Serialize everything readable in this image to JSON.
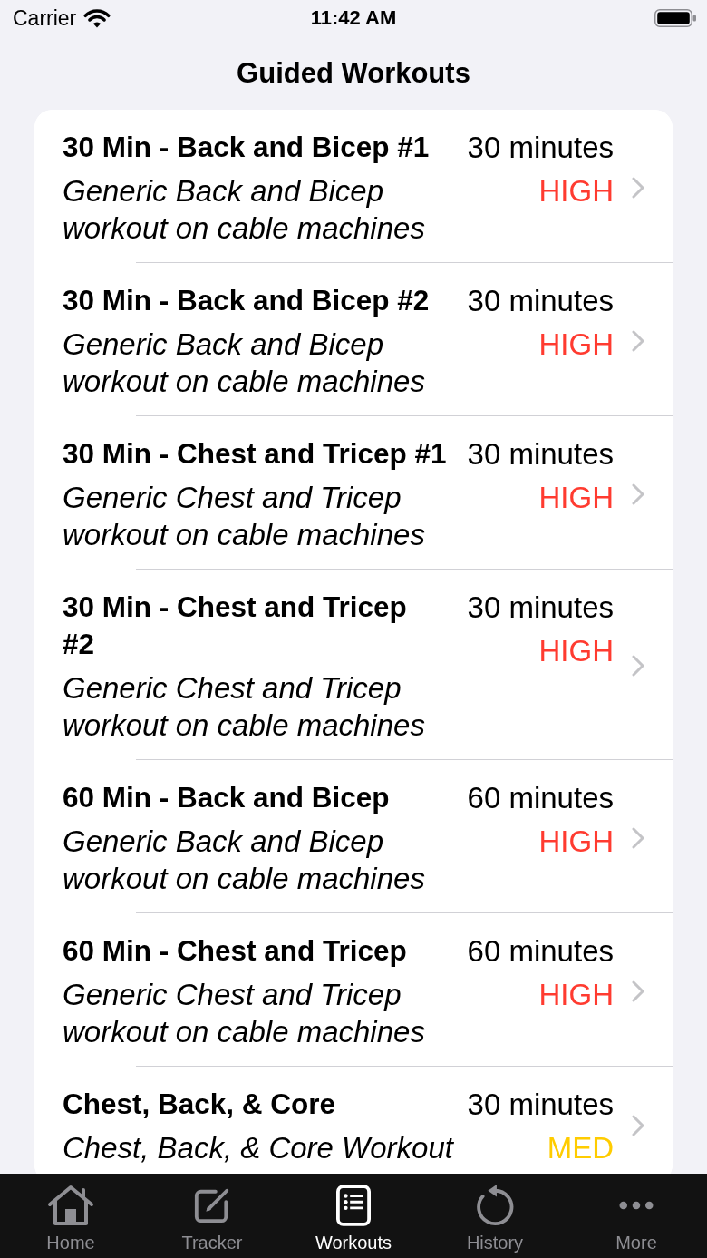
{
  "status_bar": {
    "carrier": "Carrier",
    "time": "11:42 AM"
  },
  "navigation": {
    "title": "Guided Workouts"
  },
  "workouts": [
    {
      "title": "30 Min - Back and Bicep #1",
      "description": "Generic Back and Bicep workout on cable machines",
      "duration": "30 minutes",
      "intensity": "HIGH",
      "color": "#ff3b30"
    },
    {
      "title": "30 Min - Back and Bicep #2",
      "description": "Generic Back and Bicep workout on cable machines",
      "duration": "30 minutes",
      "intensity": "HIGH",
      "color": "#ff3b30"
    },
    {
      "title": "30 Min - Chest and Tricep #1",
      "description": "Generic Chest and Tricep workout on cable machines",
      "duration": "30 minutes",
      "intensity": "HIGH",
      "color": "#ff3b30"
    },
    {
      "title": "30 Min - Chest and Tricep\n#2",
      "description": "Generic Chest and Tricep workout on cable machines",
      "duration": "30 minutes",
      "intensity": "HIGH",
      "color": "#ff3b30"
    },
    {
      "title": "60 Min - Back and Bicep",
      "description": "Generic Back and Bicep workout on cable machines",
      "duration": "60 minutes",
      "intensity": "HIGH",
      "color": "#ff3b30"
    },
    {
      "title": "60 Min - Chest and Tricep",
      "description": "Generic Chest and Tricep workout on cable machines",
      "duration": "60 minutes",
      "intensity": "HIGH",
      "color": "#ff3b30"
    },
    {
      "title": "Chest, Back, & Core",
      "description": "Chest, Back, & Core Workout",
      "duration": "30 minutes",
      "intensity": "MED",
      "color": "#ffcc00"
    }
  ],
  "tab_bar": {
    "tabs": [
      {
        "label": "Home",
        "selected": false
      },
      {
        "label": "Tracker",
        "selected": false
      },
      {
        "label": "Workouts",
        "selected": true
      },
      {
        "label": "History",
        "selected": false
      },
      {
        "label": "More",
        "selected": false
      }
    ]
  }
}
